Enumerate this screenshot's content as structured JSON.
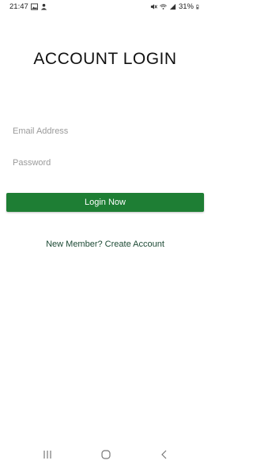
{
  "status_bar": {
    "time": "21:47",
    "battery": "31%"
  },
  "login": {
    "title": "ACCOUNT LOGIN",
    "email_placeholder": "Email Address",
    "password_placeholder": "Password",
    "login_button": "Login Now",
    "create_account_link": "New Member? Create Account"
  },
  "colors": {
    "button_bg": "#1e7e34",
    "link_text": "#1d4a35"
  },
  "nav_bar": {
    "icons": [
      "recents-icon",
      "home-icon",
      "back-icon"
    ]
  }
}
